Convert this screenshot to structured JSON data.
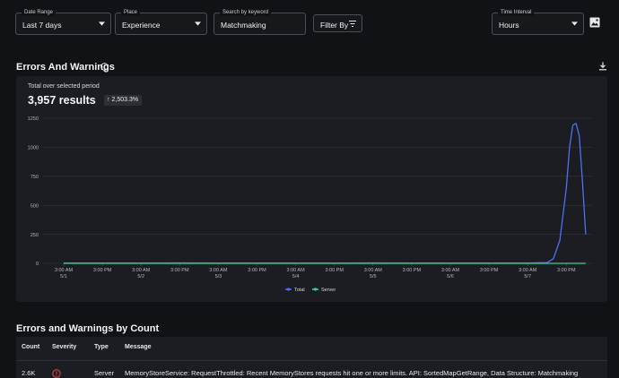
{
  "filters": {
    "date_range": {
      "label": "Date Range",
      "value": "Last 7 days"
    },
    "place": {
      "label": "Place",
      "value": "Experience"
    },
    "search": {
      "label": "Search by keyword",
      "value": "Matchmaking"
    },
    "filter_by": "Filter By",
    "time_interval": {
      "label": "Time Interval",
      "value": "Hours"
    }
  },
  "errors_section": {
    "title": "Errors And Warnings",
    "total_label": "Total over selected period",
    "total_value": "3,957 results",
    "change": "2,503.3%"
  },
  "chart_data": {
    "type": "line",
    "ylim": [
      0,
      1250
    ],
    "y_ticks": [
      "0",
      "250",
      "500",
      "750",
      "1000",
      "1250"
    ],
    "x_ticks": [
      {
        "time": "3:00 AM",
        "date": "5/1"
      },
      {
        "time": "3:00 PM",
        "date": ""
      },
      {
        "time": "3:00 AM",
        "date": "5/2"
      },
      {
        "time": "3:00 PM",
        "date": ""
      },
      {
        "time": "3:00 AM",
        "date": "5/3"
      },
      {
        "time": "3:00 PM",
        "date": ""
      },
      {
        "time": "3:00 AM",
        "date": "5/4"
      },
      {
        "time": "3:00 PM",
        "date": ""
      },
      {
        "time": "3:00 AM",
        "date": "5/5"
      },
      {
        "time": "3:00 PM",
        "date": ""
      },
      {
        "time": "3:00 AM",
        "date": "5/6"
      },
      {
        "time": "3:00 PM",
        "date": ""
      },
      {
        "time": "3:00 AM",
        "date": "5/7"
      },
      {
        "time": "3:00 PM",
        "date": ""
      }
    ],
    "series": [
      {
        "name": "Total",
        "color": "#4a72f5",
        "x_hours_from_first_tick": [
          0,
          12,
          24,
          36,
          48,
          60,
          72,
          84,
          96,
          108,
          120,
          132,
          144,
          150,
          152,
          154,
          156,
          157,
          158,
          159,
          160,
          161,
          162
        ],
        "values": [
          2,
          3,
          2,
          4,
          3,
          2,
          3,
          2,
          4,
          3,
          2,
          3,
          3,
          6,
          40,
          200,
          650,
          1000,
          1190,
          1205,
          1100,
          700,
          250
        ]
      },
      {
        "name": "Server",
        "color": "#3ecf8e",
        "x_hours_from_first_tick": [
          0,
          162
        ],
        "values": [
          0,
          0
        ]
      }
    ]
  },
  "table": {
    "title": "Errors and Warnings by Count",
    "columns": [
      "Count",
      "Severity",
      "Type",
      "Message"
    ],
    "rows": [
      {
        "count": "2.6K",
        "severity": "error",
        "type": "Server",
        "message": "MemoryStoreService: RequestThrottled: Recent MemoryStores requests hit one or more limits. API: SortedMapGetRange, Data Structure: Matchmaking"
      }
    ]
  }
}
